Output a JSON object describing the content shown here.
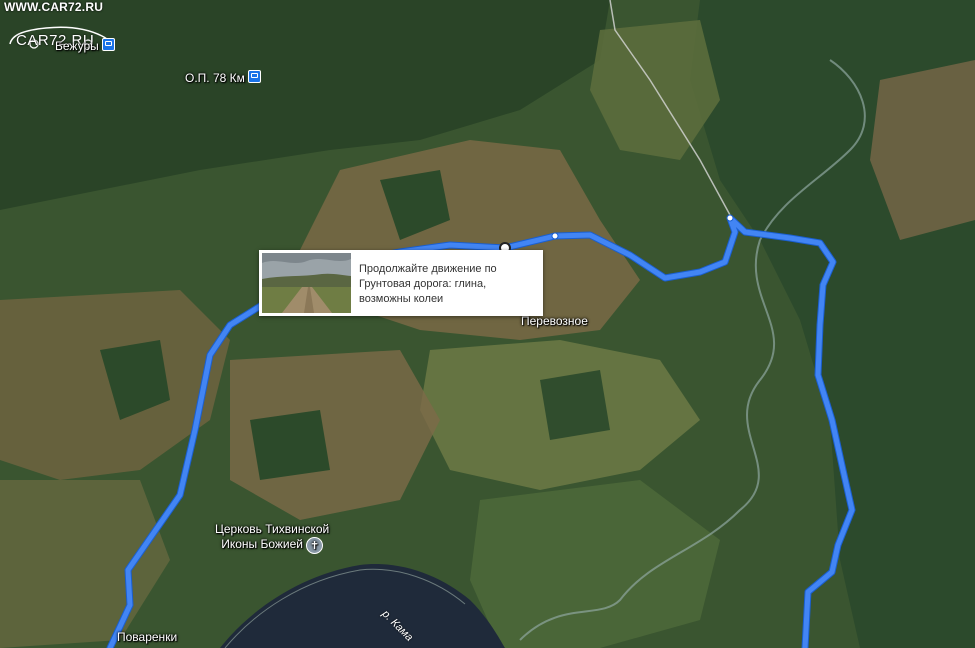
{
  "watermark": {
    "site": "WWW.CAR72.RU",
    "logo_text": "CAR72.RU"
  },
  "places": [
    {
      "id": "bezhury",
      "name": "Бежуры",
      "icon": "train-station-icon"
    },
    {
      "id": "op78",
      "name": "О.П. 78 Км",
      "icon": "train-station-icon"
    },
    {
      "id": "perevoznoe",
      "name": "Перевозное"
    },
    {
      "id": "church",
      "name_line1": "Церковь Тихвинской",
      "name_line2": "Иконы Божией",
      "icon": "church-icon"
    },
    {
      "id": "povarenki",
      "name": "Поваренки"
    }
  ],
  "river": {
    "name": "р. Кама"
  },
  "popup": {
    "line1": "Продолжайте движение по",
    "line2": "Грунтовая дорога: глина,",
    "line3": "возможны колеи",
    "thumbnail": "dirt-road-photo"
  },
  "colors": {
    "route": "#4285f4",
    "route_outline": "#1a5fd0",
    "river_dark": "#1f2a3a",
    "forest": "#2e4a2b",
    "field_light": "#6b7a45",
    "field_brown": "#8a6b4e"
  }
}
